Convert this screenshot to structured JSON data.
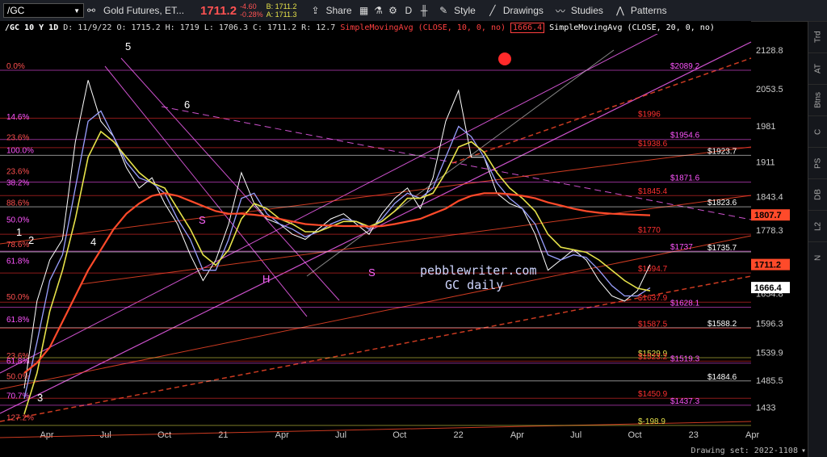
{
  "toolbar": {
    "symbol": "/GC",
    "description": "Gold Futures, ET...",
    "price": "1711.2",
    "change": "-4.60",
    "change_pct": "-0.28%",
    "bid": "B: 1711.2",
    "ask": "A: 1711.3",
    "share_label": "Share",
    "style_label": "Style",
    "drawings_label": "Drawings",
    "studies_label": "Studies",
    "patterns_label": "Patterns",
    "d_label": "D"
  },
  "info": {
    "title": "/GC 10 Y 1D",
    "date": "D: 11/9/22",
    "open": "O: 1715.2",
    "high": "H: 1719",
    "low": "L: 1706.3",
    "close": "C: 1711.2",
    "range": "R: 12.7",
    "sma10_label": "SimpleMovingAvg (CLOSE, 10, 0, no)",
    "sma10_value": "1666.4",
    "sma20_label": "SimpleMovingAvg (CLOSE, 20, 0, no)"
  },
  "right_tabs": [
    "Trd",
    "AT",
    "Btns",
    "C",
    "PS",
    "DB",
    "L2",
    "N"
  ],
  "status": {
    "drawing_set": "Drawing set: 2022-1108"
  },
  "watermark": {
    "line1": "pebblewriter.com",
    "line2": "GC daily"
  },
  "colors": {
    "bg": "#000000",
    "price": "#ffffff",
    "sma10": "#9aa0ff",
    "sma20": "#e6e24a",
    "sma_long": "#ff4a2a",
    "fib": "#ff55ff",
    "accent": "#ff5252"
  },
  "chart_data": {
    "type": "line",
    "symbol": "/GC",
    "title": "/GC 10 Y 1D",
    "xlabel": "",
    "ylabel": "",
    "ylim": [
      1390,
      2160
    ],
    "x_ticks": [
      "Apr",
      "Jul",
      "Oct",
      "21",
      "Apr",
      "Jul",
      "Oct",
      "22",
      "Apr",
      "Jul",
      "Oct",
      "23",
      "Apr"
    ],
    "y_ticks": [
      2128.8,
      2053.5,
      1981,
      1911,
      1843.4,
      1778.3,
      1654.8,
      1596.3,
      1539.9,
      1485.5,
      1433
    ],
    "price_tags": [
      {
        "label": "1807.7",
        "value": 1807.7,
        "color": "#ff4a2a"
      },
      {
        "label": "1711.2",
        "value": 1711.2,
        "color": "#ff4a2a"
      },
      {
        "label": "1666.4",
        "value": 1666.4,
        "color": "#ffffff"
      }
    ],
    "levels": [
      {
        "label": "$2089.2",
        "value": 2089.2,
        "color": "#ff55ff"
      },
      {
        "label": "$1996",
        "value": 1996,
        "color": "#ff3030"
      },
      {
        "label": "$1954.6",
        "value": 1954.6,
        "color": "#ff55ff"
      },
      {
        "label": "$1938.6",
        "value": 1938.6,
        "color": "#ff3030"
      },
      {
        "label": "$1923.7",
        "value": 1923.7,
        "color": "#ffffff"
      },
      {
        "label": "$1871.6",
        "value": 1871.6,
        "color": "#ff55ff"
      },
      {
        "label": "$1845.4",
        "value": 1845.4,
        "color": "#ff3030"
      },
      {
        "label": "$1823.6",
        "value": 1823.6,
        "color": "#ffffff"
      },
      {
        "label": "$1770",
        "value": 1770,
        "color": "#ff3030"
      },
      {
        "label": "$1737",
        "value": 1737,
        "color": "#ff55ff"
      },
      {
        "label": "$1735.7",
        "value": 1735.7,
        "color": "#ffffff"
      },
      {
        "label": "$1694.7",
        "value": 1694.7,
        "color": "#ff3030"
      },
      {
        "label": "$1637.9",
        "value": 1637.9,
        "color": "#ff3030"
      },
      {
        "label": "$1628.1",
        "value": 1628.1,
        "color": "#ff55ff"
      },
      {
        "label": "$1588.2",
        "value": 1588.2,
        "color": "#ffffff"
      },
      {
        "label": "$1587.5",
        "value": 1587.5,
        "color": "#ff3030"
      },
      {
        "label": "$1529.9",
        "value": 1529.9,
        "color": "#e6e24a"
      },
      {
        "label": "$1523.2",
        "value": 1523.2,
        "color": "#ff3030"
      },
      {
        "label": "$1519.3",
        "value": 1519.3,
        "color": "#ff55ff"
      },
      {
        "label": "$1484.6",
        "value": 1484.6,
        "color": "#ffffff"
      },
      {
        "label": "$1450.9",
        "value": 1450.9,
        "color": "#ff3030"
      },
      {
        "label": "$1437.3",
        "value": 1437.3,
        "color": "#ff55ff"
      },
      {
        "label": "$-198.9",
        "value": 1398,
        "color": "#e6e24a"
      }
    ],
    "fib_left": [
      {
        "label": "0.0%",
        "value": 2089
      },
      {
        "label": "14.6%",
        "value": 1990
      },
      {
        "label": "23.6%",
        "value": 1950
      },
      {
        "label": "100.0%",
        "value": 1925
      },
      {
        "label": "23.6%",
        "value": 1884
      },
      {
        "label": "38.2%",
        "value": 1862
      },
      {
        "label": "88.6%",
        "value": 1823
      },
      {
        "label": "50.0%",
        "value": 1790
      },
      {
        "label": "78.6%",
        "value": 1742
      },
      {
        "label": "61.8%",
        "value": 1710
      },
      {
        "label": "50.0%",
        "value": 1640
      },
      {
        "label": "61.8%",
        "value": 1596
      },
      {
        "label": "23.6%",
        "value": 1525
      },
      {
        "label": "61.8%",
        "value": 1515
      },
      {
        "label": "50.0%",
        "value": 1485
      },
      {
        "label": "70.7%",
        "value": 1447
      },
      {
        "label": "127.2%",
        "value": 1405
      }
    ],
    "wave_labels": [
      "5",
      "6",
      "4",
      "1",
      "2",
      "3",
      "H",
      "S",
      "S"
    ],
    "series": [
      {
        "name": "Price",
        "values": [
          1470,
          1640,
          1720,
          1760,
          1950,
          2070,
          1990,
          1960,
          1900,
          1860,
          1880,
          1830,
          1790,
          1730,
          1680,
          1720,
          1790,
          1890,
          1830,
          1800,
          1790,
          1770,
          1760,
          1780,
          1800,
          1810,
          1790,
          1770,
          1810,
          1840,
          1860,
          1820,
          1880,
          1990,
          2050,
          1920,
          1920,
          1850,
          1830,
          1820,
          1770,
          1700,
          1720,
          1740,
          1720,
          1680,
          1650,
          1640,
          1660,
          1711
        ]
      },
      {
        "name": "SMA10",
        "values": [
          1450,
          1560,
          1680,
          1730,
          1860,
          1990,
          2010,
          1960,
          1910,
          1880,
          1870,
          1850,
          1800,
          1760,
          1700,
          1700,
          1760,
          1840,
          1850,
          1810,
          1790,
          1780,
          1765,
          1775,
          1790,
          1800,
          1795,
          1780,
          1800,
          1830,
          1850,
          1840,
          1860,
          1920,
          1980,
          1960,
          1920,
          1870,
          1840,
          1820,
          1790,
          1730,
          1720,
          1730,
          1725,
          1700,
          1670,
          1650,
          1650,
          1666
        ]
      },
      {
        "name": "SMA20",
        "values": [
          1420,
          1500,
          1620,
          1700,
          1800,
          1920,
          1970,
          1950,
          1920,
          1890,
          1870,
          1860,
          1820,
          1780,
          1730,
          1710,
          1740,
          1800,
          1830,
          1820,
          1800,
          1790,
          1775,
          1775,
          1785,
          1795,
          1795,
          1785,
          1795,
          1815,
          1840,
          1840,
          1850,
          1890,
          1940,
          1950,
          1930,
          1890,
          1860,
          1840,
          1815,
          1770,
          1745,
          1740,
          1735,
          1720,
          1700,
          1680,
          1665,
          1660
        ]
      },
      {
        "name": "SMA200",
        "values": [
          1500,
          1520,
          1550,
          1600,
          1650,
          1700,
          1740,
          1780,
          1810,
          1830,
          1845,
          1850,
          1845,
          1835,
          1825,
          1815,
          1810,
          1810,
          1808,
          1805,
          1800,
          1795,
          1790,
          1788,
          1787,
          1786,
          1786,
          1785,
          1786,
          1790,
          1795,
          1800,
          1810,
          1820,
          1835,
          1845,
          1850,
          1850,
          1848,
          1845,
          1840,
          1832,
          1826,
          1820,
          1815,
          1812,
          1810,
          1809,
          1808,
          1807
        ]
      }
    ]
  }
}
